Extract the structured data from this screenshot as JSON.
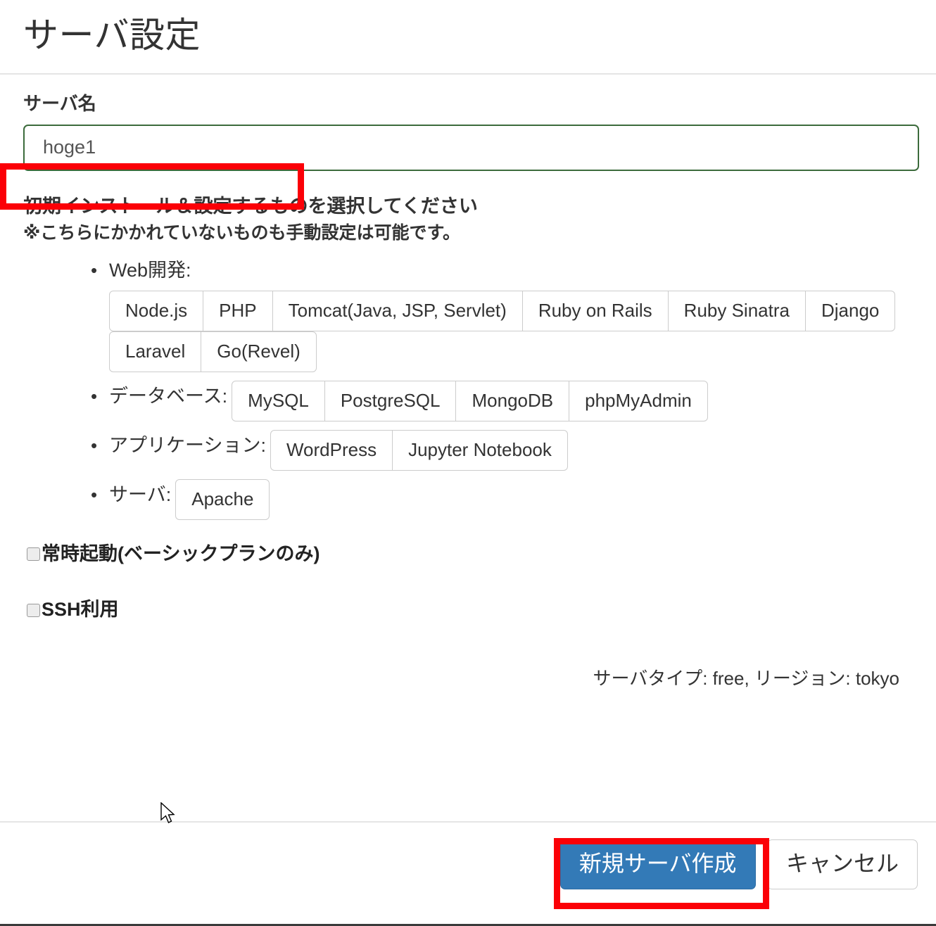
{
  "window": {
    "title": "サーバ設定"
  },
  "form": {
    "name_label": "サーバ名",
    "name_value": "hoge1",
    "name_placeholder": "サーバ名"
  },
  "install": {
    "heading": "初期インストール＆設定するものを選択してください",
    "note": "※こちらにかかれていないものも手動設定は可能です。",
    "groups": [
      {
        "label": "Web開発:",
        "layout": "stacked",
        "rows": [
          [
            "Node.js",
            "PHP",
            "Tomcat(Java, JSP, Servlet)",
            "Ruby on Rails",
            "Ruby Sinatra",
            "Django"
          ],
          [
            "Laravel",
            "Go(Revel)"
          ]
        ]
      },
      {
        "label": "データベース:",
        "layout": "inline",
        "rows": [
          [
            "MySQL",
            "PostgreSQL",
            "MongoDB",
            "phpMyAdmin"
          ]
        ]
      },
      {
        "label": "アプリケーション:",
        "layout": "inline",
        "rows": [
          [
            "WordPress",
            "Jupyter Notebook"
          ]
        ]
      },
      {
        "label": "サーバ:",
        "layout": "inline",
        "rows": [
          [
            "Apache"
          ]
        ]
      }
    ]
  },
  "checkboxes": [
    {
      "label": "常時起動(ベーシックプランのみ)",
      "checked": false
    },
    {
      "label": "SSH利用",
      "checked": false
    }
  ],
  "meta": {
    "summary": "サーバタイプ: free, リージョン: tokyo"
  },
  "footer": {
    "submit_label": "新規サーバ作成",
    "cancel_label": "キャンセル"
  },
  "colors": {
    "primary": "#337ab7",
    "annotation": "#fb0007",
    "input_border": "#3c6b3c",
    "button_border": "#cccccc"
  }
}
